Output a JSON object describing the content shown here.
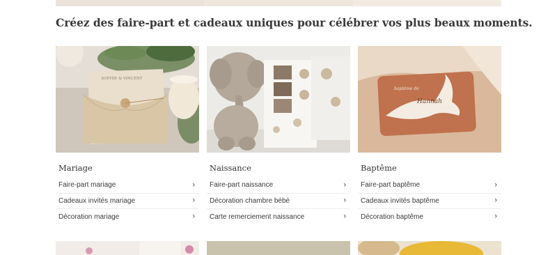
{
  "tagline": "Créez des faire-part et cadeaux uniques pour célébrer vos plus beaux moments.",
  "categories": [
    {
      "title": "Mariage",
      "image": "wedding-invitation-photo",
      "links": [
        "Faire-part mariage",
        "Cadeaux invités mariage",
        "Décoration mariage"
      ]
    },
    {
      "title": "Naissance",
      "image": "birth-announcement-elephant-photo",
      "links": [
        "Faire-part naissance",
        "Décoration chambre bébé",
        "Carte remerciement naissance"
      ]
    },
    {
      "title": "Baptême",
      "image": "baptism-card-dove-photo",
      "links": [
        "Faire-part baptême",
        "Cadeaux invités baptême",
        "Décoration baptême"
      ]
    }
  ],
  "card_texts": {
    "wedding": "SOPHIE & VINCENT",
    "baptism_script": "baptême de",
    "baptism_name": "Hannah"
  },
  "icons": {
    "chevron": "›"
  },
  "colors": {
    "text": "#2b2b2b",
    "divider": "#ececec",
    "wedding_bg": "#cfc7bb",
    "birth_bg": "#ecebe8",
    "baptism_bg": "#d9b89b",
    "baptism_card": "#c0714d"
  }
}
